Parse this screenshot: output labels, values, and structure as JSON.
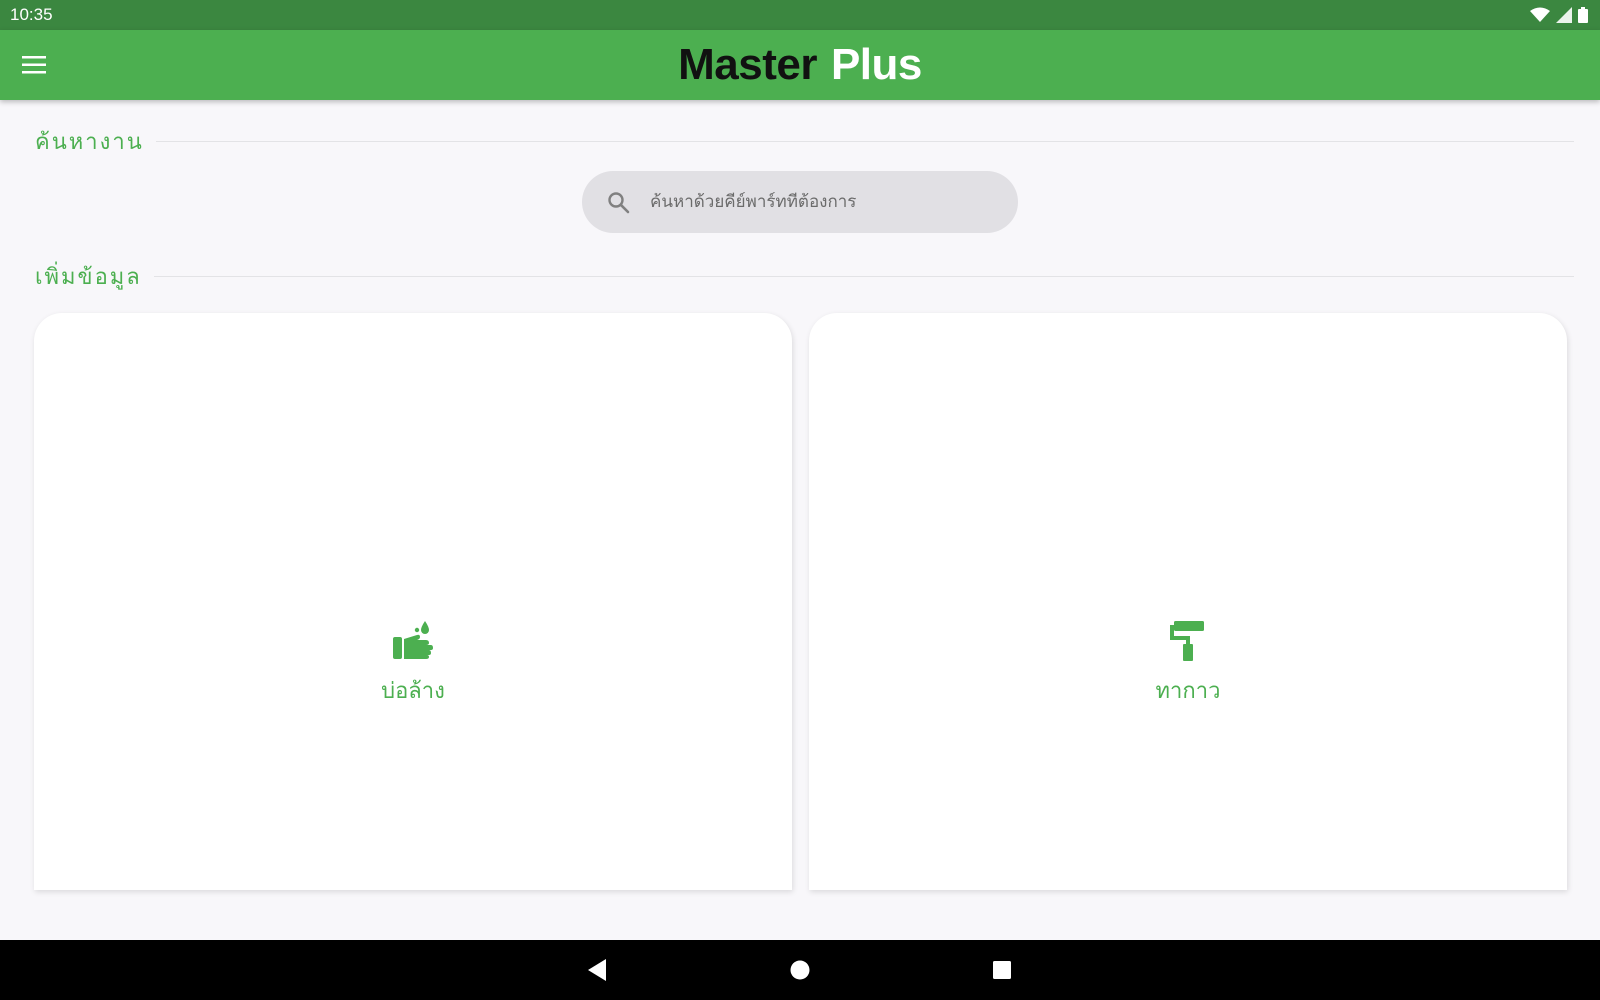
{
  "status_bar": {
    "time": "10:35"
  },
  "app_bar": {
    "brand_part1": "Master",
    "brand_part2": "Plus"
  },
  "search_section": {
    "title": "ค้นหางาน",
    "placeholder": "ค้นหาด้วยคีย์พาร์ทที่ต้องการ"
  },
  "add_section": {
    "title": "เพิ่มข้อมูล",
    "cards": [
      {
        "label": "บ่อล้าง",
        "icon": "hand-wash-icon"
      },
      {
        "label": "ทากาว",
        "icon": "paint-roller-icon"
      }
    ]
  },
  "colors": {
    "primary": "#4caf50",
    "status_bar": "#3b8740",
    "background": "#f8f7fa"
  }
}
